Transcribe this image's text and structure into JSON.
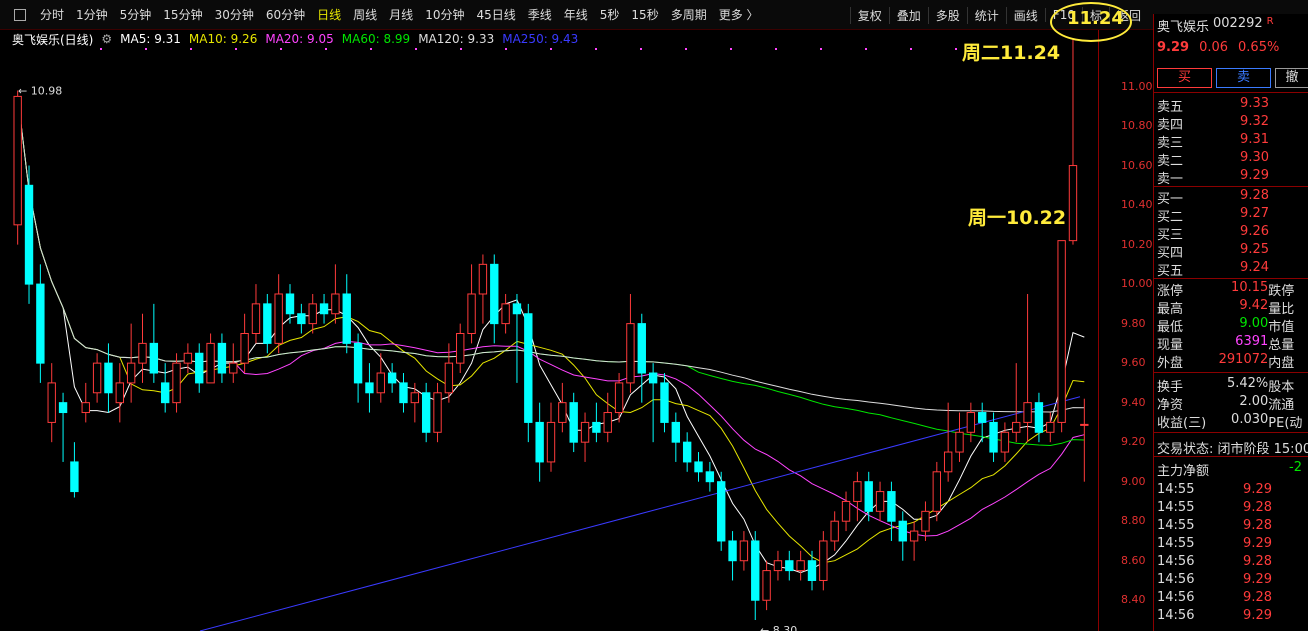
{
  "topbar": {
    "tabs": [
      "分时",
      "1分钟",
      "5分钟",
      "15分钟",
      "30分钟",
      "60分钟",
      "日线",
      "周线",
      "月线",
      "10分钟",
      "45日线",
      "季线",
      "年线",
      "5秒",
      "15秒",
      "多周期",
      "更多 〉"
    ],
    "active_tab": "日线",
    "tools": [
      "复权",
      "叠加",
      "多股",
      "统计",
      "画线",
      "F10",
      "标",
      "返回"
    ]
  },
  "legend": {
    "stock": "奥飞娱乐(日线)",
    "ma": [
      {
        "label": "MA5: 9.31",
        "color": "#ffffff"
      },
      {
        "label": "MA10: 9.26",
        "color": "#e6e600"
      },
      {
        "label": "MA20: 9.05",
        "color": "#ff44ff"
      },
      {
        "label": "MA60: 8.99",
        "color": "#00e600"
      },
      {
        "label": "MA120: 9.33",
        "color": "#dddddd"
      },
      {
        "label": "MA250: 9.43",
        "color": "#3a3aff"
      }
    ]
  },
  "annotations": {
    "tuesday": "周二11.24",
    "monday": "周一10.22",
    "circled": "11.24",
    "high_label": "10.98",
    "low_label": "8.30"
  },
  "chart_data": {
    "type": "candlestick",
    "ylim": [
      8.3,
      11.2
    ],
    "yticks": [
      "11.00",
      "10.80",
      "10.60",
      "10.40",
      "10.20",
      "10.00",
      "9.80",
      "9.60",
      "9.40",
      "9.20",
      "9.00",
      "8.80",
      "8.60",
      "8.40"
    ],
    "candles": [
      [
        10.3,
        10.95,
        10.98,
        10.2
      ],
      [
        10.5,
        10.0,
        10.6,
        9.9
      ],
      [
        10.0,
        9.6,
        10.1,
        9.5
      ],
      [
        9.3,
        9.5,
        9.6,
        9.2
      ],
      [
        9.4,
        9.35,
        9.45,
        9.1
      ],
      [
        9.1,
        8.95,
        9.2,
        8.92
      ],
      [
        9.35,
        9.4,
        9.5,
        9.3
      ],
      [
        9.45,
        9.6,
        9.65,
        9.4
      ],
      [
        9.6,
        9.45,
        9.7,
        9.35
      ],
      [
        9.4,
        9.5,
        9.6,
        9.3
      ],
      [
        9.5,
        9.6,
        9.8,
        9.4
      ],
      [
        9.6,
        9.7,
        9.85,
        9.5
      ],
      [
        9.7,
        9.55,
        9.9,
        9.5
      ],
      [
        9.5,
        9.4,
        9.6,
        9.35
      ],
      [
        9.4,
        9.6,
        9.65,
        9.35
      ],
      [
        9.6,
        9.65,
        9.7,
        9.55
      ],
      [
        9.65,
        9.5,
        9.7,
        9.45
      ],
      [
        9.5,
        9.7,
        9.75,
        9.5
      ],
      [
        9.7,
        9.55,
        9.75,
        9.5
      ],
      [
        9.55,
        9.6,
        9.7,
        9.5
      ],
      [
        9.6,
        9.75,
        9.85,
        9.55
      ],
      [
        9.75,
        9.9,
        10.0,
        9.7
      ],
      [
        9.9,
        9.7,
        9.95,
        9.65
      ],
      [
        9.7,
        9.95,
        10.05,
        9.65
      ],
      [
        9.95,
        9.85,
        10.0,
        9.8
      ],
      [
        9.85,
        9.8,
        9.9,
        9.75
      ],
      [
        9.8,
        9.9,
        9.95,
        9.75
      ],
      [
        9.9,
        9.85,
        9.95,
        9.8
      ],
      [
        9.85,
        9.95,
        10.1,
        9.8
      ],
      [
        9.95,
        9.7,
        10.05,
        9.65
      ],
      [
        9.7,
        9.5,
        9.75,
        9.4
      ],
      [
        9.5,
        9.45,
        9.6,
        9.35
      ],
      [
        9.45,
        9.55,
        9.65,
        9.4
      ],
      [
        9.55,
        9.5,
        9.6,
        9.45
      ],
      [
        9.5,
        9.4,
        9.55,
        9.35
      ],
      [
        9.4,
        9.45,
        9.5,
        9.3
      ],
      [
        9.45,
        9.25,
        9.5,
        9.2
      ],
      [
        9.25,
        9.45,
        9.5,
        9.2
      ],
      [
        9.45,
        9.6,
        9.7,
        9.4
      ],
      [
        9.6,
        9.75,
        9.8,
        9.55
      ],
      [
        9.75,
        9.95,
        10.1,
        9.7
      ],
      [
        9.95,
        10.1,
        10.15,
        9.8
      ],
      [
        10.1,
        9.8,
        10.15,
        9.7
      ],
      [
        9.8,
        9.9,
        9.95,
        9.75
      ],
      [
        9.9,
        9.85,
        9.95,
        9.5
      ],
      [
        9.85,
        9.3,
        9.9,
        9.2
      ],
      [
        9.3,
        9.1,
        9.4,
        9.0
      ],
      [
        9.1,
        9.3,
        9.4,
        9.05
      ],
      [
        9.3,
        9.4,
        9.5,
        9.25
      ],
      [
        9.4,
        9.2,
        9.45,
        9.15
      ],
      [
        9.2,
        9.3,
        9.35,
        9.1
      ],
      [
        9.3,
        9.25,
        9.4,
        9.2
      ],
      [
        9.25,
        9.35,
        9.45,
        9.2
      ],
      [
        9.35,
        9.5,
        9.55,
        9.3
      ],
      [
        9.5,
        9.8,
        9.95,
        9.45
      ],
      [
        9.8,
        9.55,
        9.85,
        9.4
      ],
      [
        9.55,
        9.5,
        9.6,
        9.2
      ],
      [
        9.5,
        9.3,
        9.55,
        9.25
      ],
      [
        9.3,
        9.2,
        9.35,
        9.1
      ],
      [
        9.2,
        9.1,
        9.25,
        9.05
      ],
      [
        9.1,
        9.05,
        9.15,
        9.0
      ],
      [
        9.05,
        9.0,
        9.1,
        8.95
      ],
      [
        9.0,
        8.7,
        9.05,
        8.65
      ],
      [
        8.7,
        8.6,
        8.75,
        8.5
      ],
      [
        8.6,
        8.7,
        8.75,
        8.55
      ],
      [
        8.7,
        8.4,
        8.75,
        8.3
      ],
      [
        8.4,
        8.55,
        8.6,
        8.35
      ],
      [
        8.55,
        8.6,
        8.65,
        8.5
      ],
      [
        8.6,
        8.55,
        8.65,
        8.5
      ],
      [
        8.55,
        8.6,
        8.65,
        8.5
      ],
      [
        8.6,
        8.5,
        8.65,
        8.45
      ],
      [
        8.5,
        8.7,
        8.75,
        8.45
      ],
      [
        8.7,
        8.8,
        8.85,
        8.65
      ],
      [
        8.8,
        8.9,
        8.95,
        8.75
      ],
      [
        8.9,
        9.0,
        9.05,
        8.8
      ],
      [
        9.0,
        8.85,
        9.05,
        8.8
      ],
      [
        8.85,
        8.95,
        9.0,
        8.8
      ],
      [
        8.95,
        8.8,
        9.0,
        8.7
      ],
      [
        8.8,
        8.7,
        8.85,
        8.6
      ],
      [
        8.7,
        8.75,
        8.8,
        8.6
      ],
      [
        8.75,
        8.85,
        8.9,
        8.7
      ],
      [
        8.85,
        9.05,
        9.1,
        8.8
      ],
      [
        9.05,
        9.15,
        9.4,
        9.0
      ],
      [
        9.15,
        9.25,
        9.35,
        9.1
      ],
      [
        9.25,
        9.35,
        9.4,
        9.2
      ],
      [
        9.35,
        9.3,
        9.4,
        9.2
      ],
      [
        9.3,
        9.15,
        9.35,
        9.1
      ],
      [
        9.15,
        9.25,
        9.3,
        9.1
      ],
      [
        9.25,
        9.3,
        9.6,
        9.2
      ],
      [
        9.3,
        9.4,
        9.95,
        9.2
      ],
      [
        9.4,
        9.25,
        9.45,
        9.2
      ],
      [
        9.25,
        9.3,
        9.35,
        9.2
      ],
      [
        9.3,
        10.22,
        10.22,
        9.25
      ],
      [
        10.22,
        10.6,
        11.24,
        10.2
      ],
      [
        9.29,
        9.29,
        9.42,
        9.0
      ]
    ]
  },
  "sidebar": {
    "name": "奥飞娱乐",
    "code": "002292",
    "flag": "R",
    "price": "9.29",
    "change": "0.06",
    "pct": "0.65%",
    "buy": "买",
    "sell": "卖",
    "cancel": "撤",
    "asks": [
      [
        "卖五",
        "9.33"
      ],
      [
        "卖四",
        "9.32"
      ],
      [
        "卖三",
        "9.31"
      ],
      [
        "卖二",
        "9.30"
      ],
      [
        "卖一",
        "9.29"
      ]
    ],
    "bids": [
      [
        "买一",
        "9.28"
      ],
      [
        "买二",
        "9.27"
      ],
      [
        "买三",
        "9.26"
      ],
      [
        "买四",
        "9.25"
      ],
      [
        "买五",
        "9.24"
      ]
    ],
    "stats": [
      [
        "涨停",
        "10.15",
        "跌停"
      ],
      [
        "最高",
        "9.42",
        "量比"
      ],
      [
        "最低",
        "9.00",
        "市值"
      ],
      [
        "现量",
        "6391",
        "总量"
      ],
      [
        "外盘",
        "291072",
        "内盘"
      ]
    ],
    "stats2": [
      [
        "换手",
        "5.42%",
        "股本"
      ],
      [
        "净资",
        "2.00",
        "流通"
      ],
      [
        "收益(三)",
        "0.030",
        "PE(动"
      ]
    ],
    "status_label": "交易状态: 闭市阶段 15:00",
    "net_label": "主力净额",
    "net_value": "-2",
    "ticks": [
      [
        "14:55",
        "9.29"
      ],
      [
        "14:55",
        "9.28"
      ],
      [
        "14:55",
        "9.28"
      ],
      [
        "14:55",
        "9.29"
      ],
      [
        "14:56",
        "9.28"
      ],
      [
        "14:56",
        "9.29"
      ],
      [
        "14:56",
        "9.28"
      ],
      [
        "14:56",
        "9.29"
      ]
    ]
  }
}
